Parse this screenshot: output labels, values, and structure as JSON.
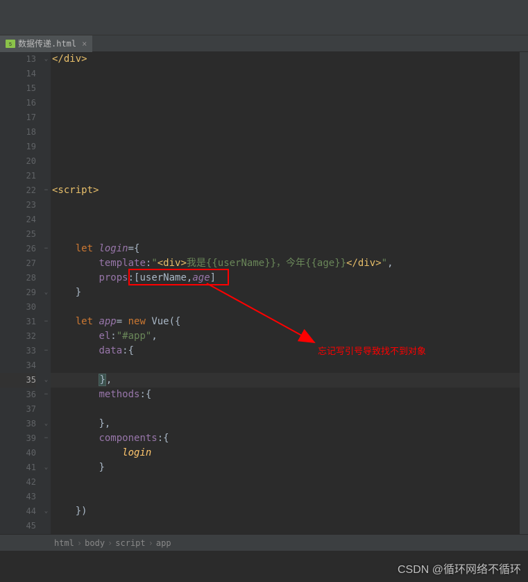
{
  "tab": {
    "filename": "数据传递.html",
    "icon": "html-file-icon"
  },
  "gutter": {
    "start": 13,
    "end": 45,
    "highlighted": 35
  },
  "code": {
    "l13": {
      "close_div": "</div>"
    },
    "l22": {
      "open_script": "<script>"
    },
    "l26": {
      "let": "let ",
      "login": "login",
      "eq": "={"
    },
    "l27": {
      "template": "template",
      "colon": ":",
      "q1": "\"",
      "div_open": "<div>",
      "txt": "我是{{userName}}，今年{{age}}",
      "div_close": "</div>",
      "q2": "\"",
      "comma": ","
    },
    "l28": {
      "props": "props",
      "colon": ":",
      "lb": "[",
      "un": "userName",
      "comma": ",",
      "age": "age",
      "rb": "]"
    },
    "l29": {
      "brace": "}"
    },
    "l31": {
      "let": "let ",
      "app": "app",
      "eq": "= ",
      "new": "new ",
      "vue": "Vue",
      "paren": "({"
    },
    "l32": {
      "el": "el",
      "colon": ":",
      "val": "\"#app\"",
      "comma": ","
    },
    "l33": {
      "data": "data",
      "colon": ":",
      "brace": "{"
    },
    "l35": {
      "brace": "}",
      "comma": ","
    },
    "l36": {
      "methods": "methods",
      "colon": ":",
      "brace": "{"
    },
    "l38": {
      "brace": "}",
      "comma": ","
    },
    "l39": {
      "components": "components",
      "colon": ":",
      "brace": "{"
    },
    "l40": {
      "login": "login"
    },
    "l41": {
      "brace": "}"
    },
    "l44": {
      "close": "})"
    }
  },
  "annotation": {
    "text": "忘记写引号导致找不到对象"
  },
  "breadcrumb": {
    "items": [
      "html",
      "body",
      "script",
      "app"
    ]
  },
  "watermark": "CSDN @循环网络不循环"
}
